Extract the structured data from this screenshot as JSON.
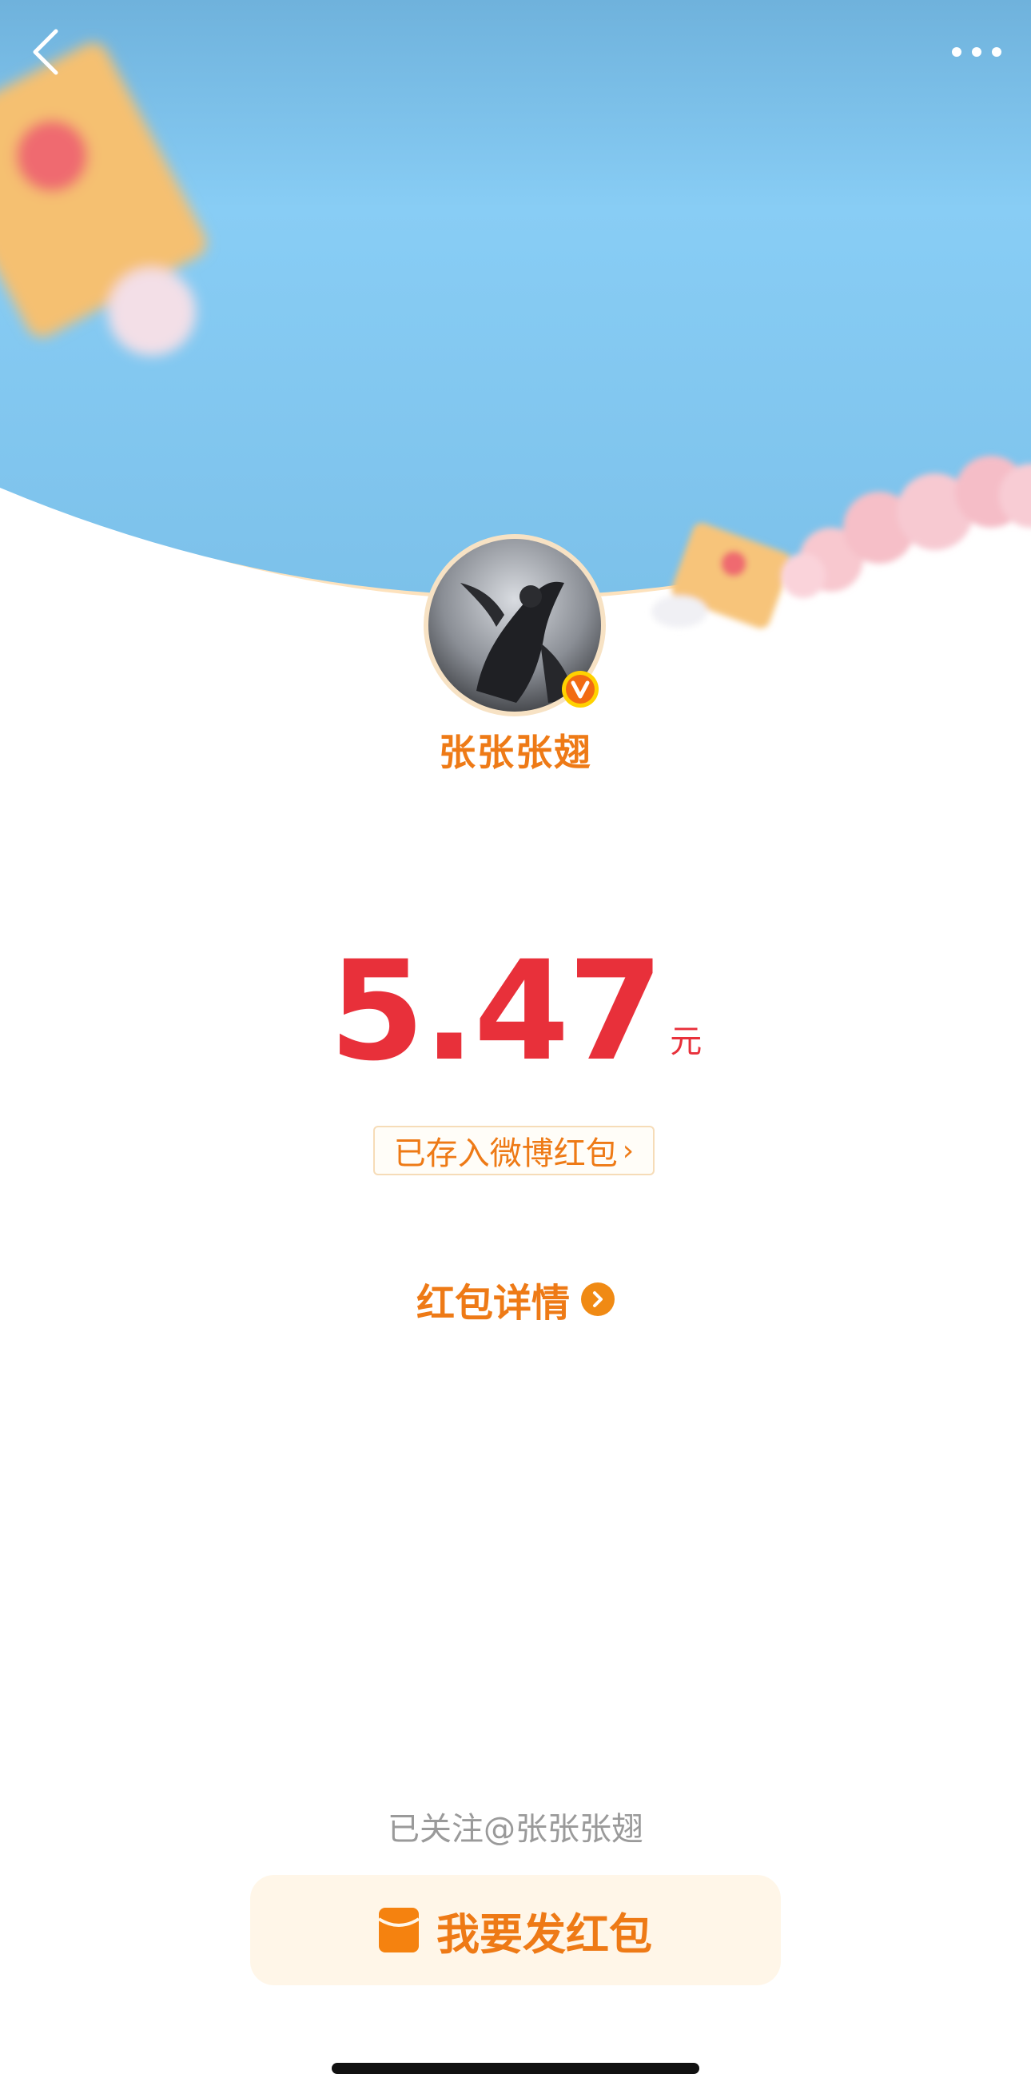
{
  "header": {
    "back_icon": "chevron-left-icon",
    "more_icon": "more-dots-icon"
  },
  "sender": {
    "name": "张张张翅",
    "verified_icon": "verified-v-badge-icon"
  },
  "amount": {
    "value": "5.47",
    "unit": "元"
  },
  "saved_tag": {
    "label": "已存入微博红包",
    "chevron": "›"
  },
  "detail": {
    "label": "红包详情",
    "icon": "arrow-circle-right-icon"
  },
  "footer": {
    "followed_text": "已关注@张张张翅",
    "send_button_label": "我要发红包",
    "send_icon": "red-envelope-icon"
  },
  "colors": {
    "accent_orange": "#ee7a16",
    "amount_red": "#e8303a",
    "banner_blue": "#7fc8f2"
  }
}
